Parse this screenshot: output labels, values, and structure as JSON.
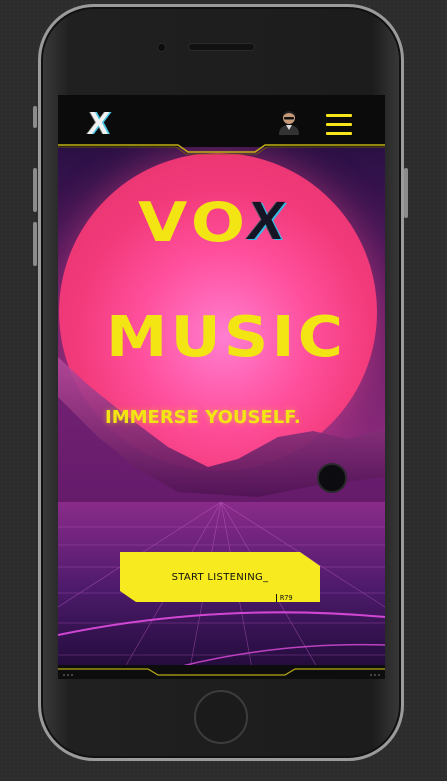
{
  "app": {
    "logo_text": "X",
    "avatar_icon": "user-avatar-icon",
    "menu_icon": "hamburger-menu-icon"
  },
  "hero": {
    "title_main": "VO",
    "title_accent": "X",
    "title_second": "MUSIC",
    "tagline": "IMMERSE YOUSELF.",
    "cta_label": "START LISTENING_",
    "cta_tag": "R79"
  },
  "colors": {
    "accent_yellow": "#f3e514",
    "sun_pink": "#ff4f9c",
    "background": "#0b0b0b"
  }
}
